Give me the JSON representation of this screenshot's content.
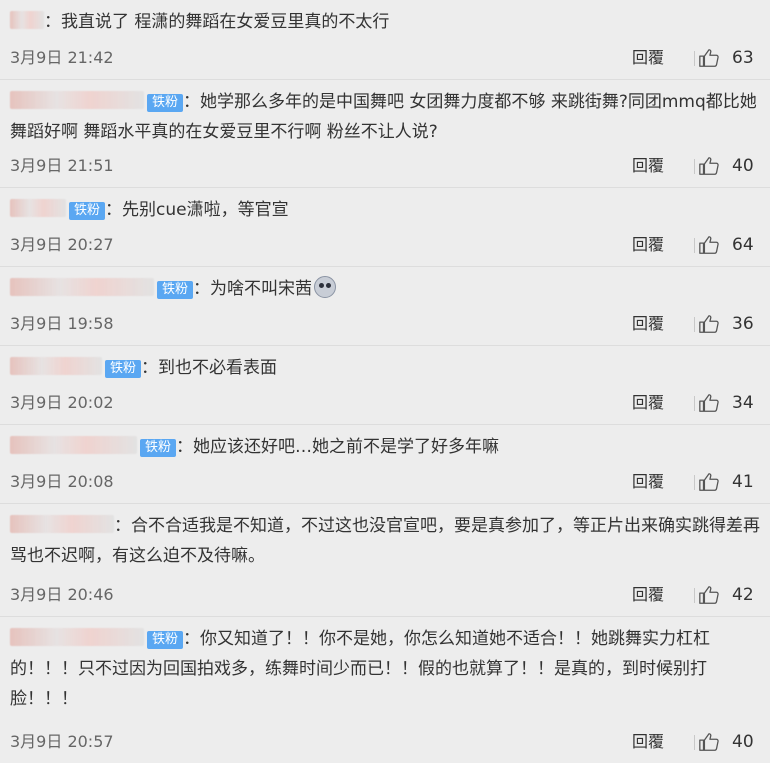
{
  "comments": [
    {
      "badge": "",
      "text": "我直说了 程潇的舞蹈在女爱豆里真的不太行",
      "emoji": false,
      "time": "3月9日 21:42",
      "reply": "回覆",
      "likes": "63"
    },
    {
      "badge": "铁粉",
      "text": "她学那么多年的是中国舞吧 女团舞力度都不够 来跳街舞?同团mmq都比她舞蹈好啊 舞蹈水平真的在女爱豆里不行啊 粉丝不让人说?",
      "emoji": false,
      "time": "3月9日 21:51",
      "reply": "回覆",
      "likes": "40"
    },
    {
      "badge": "铁粉",
      "text": "先别cue潇啦，等官宣",
      "emoji": false,
      "time": "3月9日 20:27",
      "reply": "回覆",
      "likes": "64"
    },
    {
      "badge": "铁粉",
      "text": "为啥不叫宋茜",
      "emoji": true,
      "time": "3月9日 19:58",
      "reply": "回覆",
      "likes": "36"
    },
    {
      "badge": "铁粉",
      "text": "到也不必看表面",
      "emoji": false,
      "time": "3月9日 20:02",
      "reply": "回覆",
      "likes": "34"
    },
    {
      "badge": "铁粉",
      "text": "她应该还好吧…她之前不是学了好多年嘛",
      "emoji": false,
      "time": "3月9日 20:08",
      "reply": "回覆",
      "likes": "41"
    },
    {
      "badge": "",
      "text": "合不合适我是不知道，不过这也没官宣吧，要是真参加了，等正片出来确实跳得差再骂也不迟啊，有这么迫不及待嘛。",
      "emoji": false,
      "time": "3月9日 20:46",
      "reply": "回覆",
      "likes": "42"
    },
    {
      "badge": "铁粉",
      "text": "你又知道了！！你不是她，你怎么知道她不适合！！她跳舞实力杠杠的！！！只不过因为回国拍戏多，练舞时间少而已！！假的也就算了！！是真的，到时候别打脸！！！",
      "emoji": false,
      "time": "3月9日 20:57",
      "reply": "回覆",
      "likes": "40"
    }
  ],
  "colon": "："
}
